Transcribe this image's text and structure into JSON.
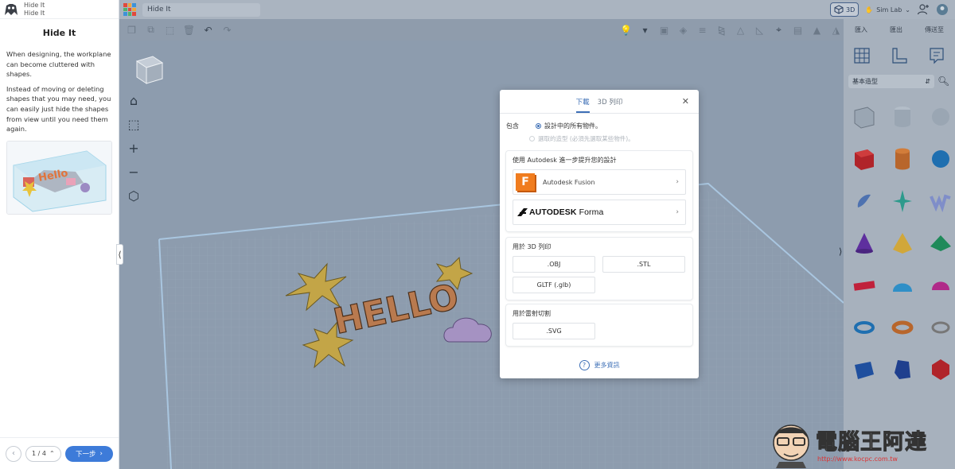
{
  "lesson": {
    "breadcrumb_top": "Hide It",
    "breadcrumb_sub": "Hide It",
    "title": "Hide It",
    "paragraph_1": "When designing, the workplane can become cluttered with shapes.",
    "paragraph_2": "Instead of moving or deleting shapes that you may need, you can easily just hide the shapes from view until you need them again.",
    "image_text": "Hello",
    "page_indicator": "1 / 4",
    "next_label": "下一步"
  },
  "topbar": {
    "design_name": "Hide It",
    "view_3d_label": "3D",
    "sim_lab_label": "Sim Lab"
  },
  "right_top": {
    "import_label": "匯入",
    "export_label": "匯出",
    "send_to_label": "傳送至"
  },
  "library": {
    "category": "基本造型"
  },
  "scene": {
    "text": "HELLO"
  },
  "modal": {
    "tab_download": "下載",
    "tab_3d_print": "3D 列印",
    "include_label": "包含",
    "option_all": "設計中的所有物件。",
    "option_selected": "選取的造型 (必須先選取某些物件)。",
    "autodesk_section_title": "使用 Autodesk 進一步提升您的設計",
    "fusion_label": "Autodesk Fusion",
    "forma_brand": "AUTODESK",
    "forma_product": "Forma",
    "print_section_title": "用於 3D 列印",
    "fmt_obj": ".OBJ",
    "fmt_stl": ".STL",
    "fmt_gltf": "GLTF (.glb)",
    "laser_section_title": "用於雷射切割",
    "fmt_svg": ".SVG",
    "more_info": "更多資訊"
  },
  "watermark": {
    "text": "電腦王阿達",
    "url": "http://www.kocpc.com.tw"
  },
  "colors": {
    "accent": "#3d6fb6",
    "next_button": "#3d7bd9",
    "fusion_orange": "#f07c1e",
    "workplane": "#8d9cae"
  }
}
